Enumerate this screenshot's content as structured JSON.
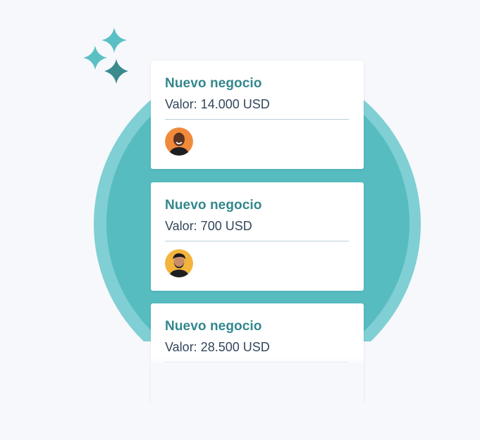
{
  "cards": [
    {
      "title": "Nuevo negocio",
      "value": "Valor: 14.000 USD",
      "avatar_icon": "person-avatar-orange",
      "avatar_color": "#f08a3a"
    },
    {
      "title": "Nuevo negocio",
      "value": "Valor: 700 USD",
      "avatar_icon": "person-avatar-yellow",
      "avatar_color": "#f3b43b"
    },
    {
      "title": "Nuevo negocio",
      "value": "Valor: 28.500 USD"
    }
  ],
  "colors": {
    "background": "#f6f8fb",
    "circle_outer": "#7fcfd4",
    "circle_inner": "#56bcc0",
    "title": "#33878d",
    "text": "#33475b",
    "sparkle_light": "#5bc0c4",
    "sparkle_dark": "#3a8a8e"
  }
}
